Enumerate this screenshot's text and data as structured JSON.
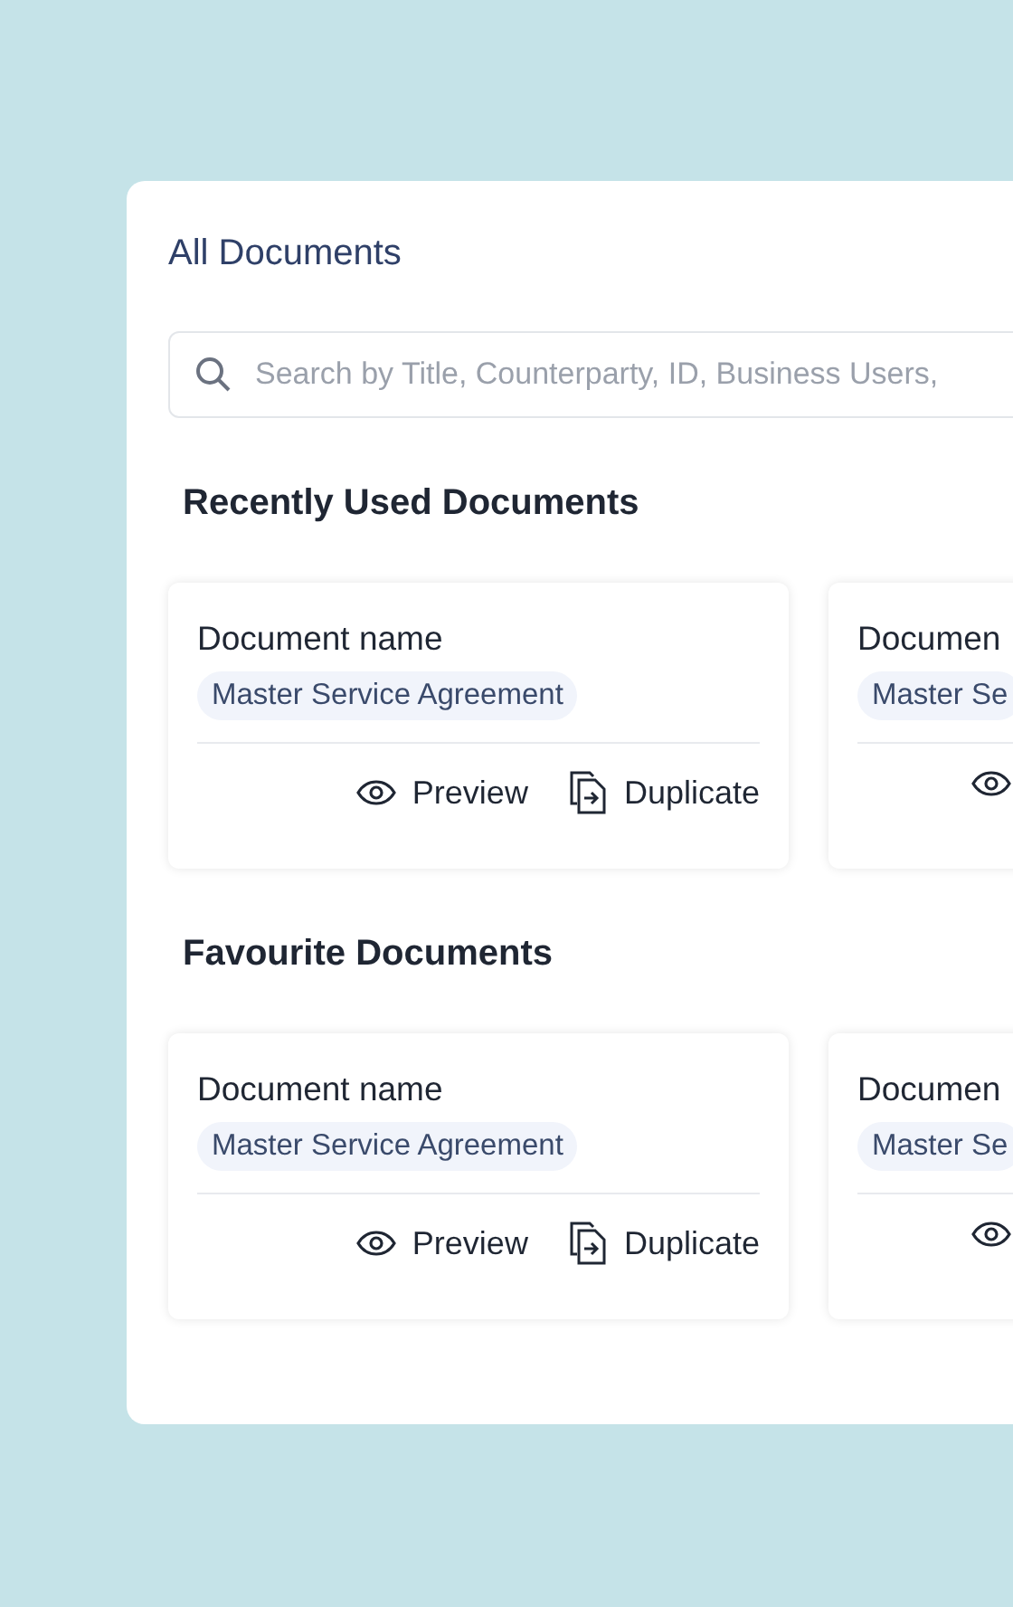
{
  "title": "All Documents",
  "search": {
    "placeholder": "Search by Title, Counterparty, ID, Business Users,"
  },
  "sections": [
    {
      "heading": "Recently Used Documents",
      "cards": [
        {
          "name": "Document name",
          "tag": "Master Service Agreement",
          "actions": [
            {
              "kind": "preview",
              "label": "Preview"
            },
            {
              "kind": "duplicate",
              "label": "Duplicate"
            }
          ]
        },
        {
          "name": "Documen",
          "tag": "Master Se",
          "actions": [
            {
              "kind": "preview"
            }
          ]
        }
      ]
    },
    {
      "heading": "Favourite Documents",
      "cards": [
        {
          "name": "Document name",
          "tag": "Master Service Agreement",
          "actions": [
            {
              "kind": "preview",
              "label": "Preview"
            },
            {
              "kind": "duplicate",
              "label": "Duplicate"
            }
          ]
        },
        {
          "name": "Documen",
          "tag": "Master Se",
          "actions": [
            {
              "kind": "preview"
            }
          ]
        }
      ]
    }
  ]
}
